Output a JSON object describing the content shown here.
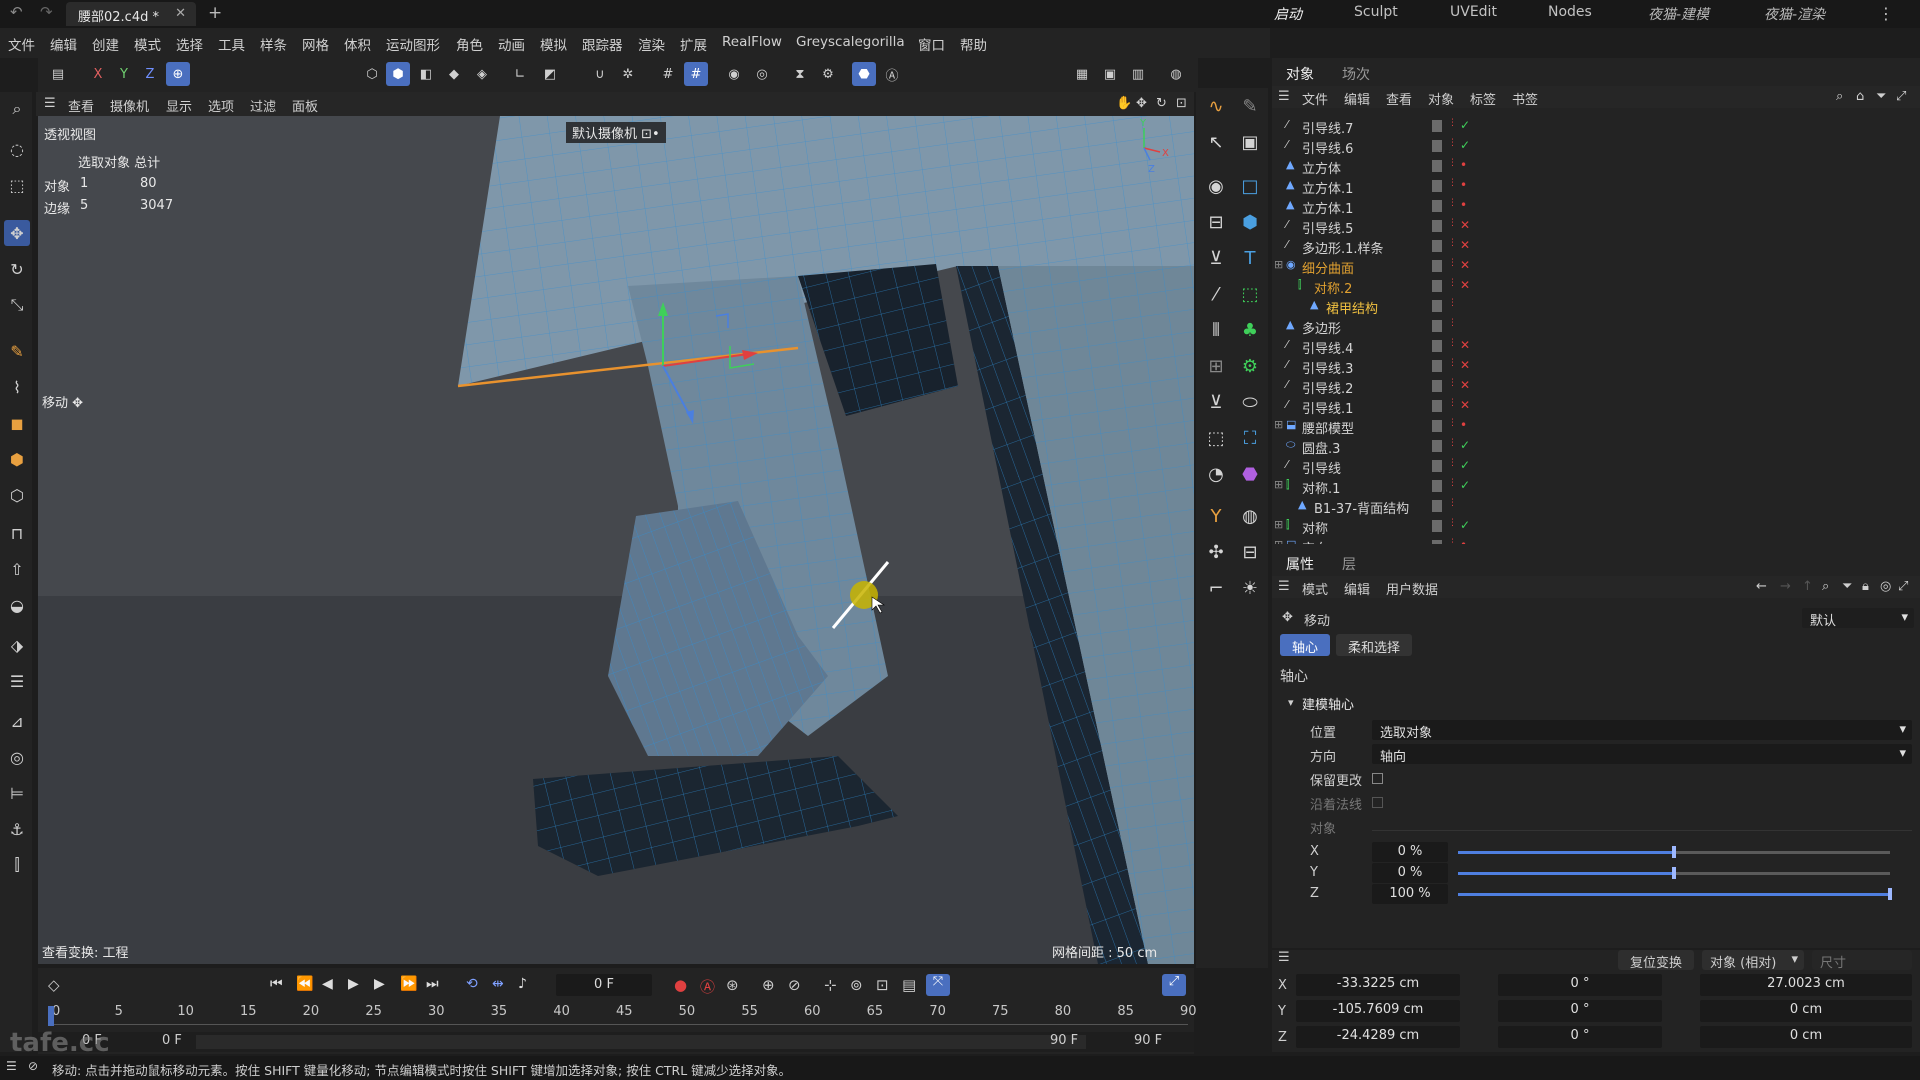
{
  "title_bar": {
    "doc_tab": "腰部02.c4d *",
    "workspaces": [
      "启动",
      "Sculpt",
      "UVEdit",
      "Nodes",
      "夜猫-建模",
      "夜猫-渲染"
    ]
  },
  "menu": [
    "文件",
    "编辑",
    "创建",
    "模式",
    "选择",
    "工具",
    "样条",
    "网格",
    "体积",
    "运动图形",
    "角色",
    "动画",
    "模拟",
    "跟踪器",
    "渲染",
    "扩展",
    "RealFlow",
    "Greyscalegorilla",
    "窗口",
    "帮助"
  ],
  "toolbar_axes": [
    "X",
    "Y",
    "Z"
  ],
  "viewport": {
    "menu": [
      "查看",
      "摄像机",
      "显示",
      "选项",
      "过滤",
      "面板"
    ],
    "name": "透视视图",
    "camera": "默认摄像机 ⊡•",
    "stats_header": "选取对象 总计",
    "stats": [
      {
        "label": "对象",
        "sel": "1",
        "total": "80"
      },
      {
        "label": "边缘",
        "sel": "5",
        "total": "3047"
      }
    ],
    "tool_label": "移动 ✥",
    "view_transform": "查看变换: 工程",
    "grid_spacing": "网格间距 : 50 cm"
  },
  "timeline": {
    "current_frame": "0 F",
    "ticks": [
      "0",
      "5",
      "10",
      "15",
      "20",
      "25",
      "30",
      "35",
      "40",
      "45",
      "50",
      "55",
      "60",
      "65",
      "70",
      "75",
      "80",
      "85",
      "90"
    ],
    "start": "0 F",
    "start2": "0 F",
    "end": "90 F",
    "end2": "90 F"
  },
  "object_manager": {
    "tabs": [
      "对象",
      "场次"
    ],
    "menu": [
      "文件",
      "编辑",
      "查看",
      "对象",
      "标签",
      "书签"
    ],
    "objects": [
      {
        "name": "引导线.7",
        "indent": 0,
        "icon": "spline-icon",
        "status": "✓",
        "status_color": "#3fcf5a",
        "color": "#d4d4d4"
      },
      {
        "name": "引导线.6",
        "indent": 0,
        "icon": "spline-icon",
        "status": "✓",
        "status_color": "#3fcf5a",
        "color": "#d4d4d4"
      },
      {
        "name": "立方体",
        "indent": 0,
        "icon": "polygon-icon",
        "status": "•",
        "status_color": "#e04040",
        "color": "#d4d4d4"
      },
      {
        "name": "立方体.1",
        "indent": 0,
        "icon": "polygon-icon",
        "status": "•",
        "status_color": "#e04040",
        "color": "#d4d4d4"
      },
      {
        "name": "立方体.1",
        "indent": 0,
        "icon": "polygon-icon",
        "status": "•",
        "status_color": "#e04040",
        "color": "#d4d4d4"
      },
      {
        "name": "引导线.5",
        "indent": 0,
        "icon": "spline-icon",
        "status": "✕",
        "status_color": "#e04040",
        "color": "#d4d4d4"
      },
      {
        "name": "多边形.1.样条",
        "indent": 0,
        "icon": "spline-icon",
        "status": "✕",
        "status_color": "#e04040",
        "color": "#d4d4d4"
      },
      {
        "name": "细分曲面",
        "indent": 0,
        "icon": "subdivision-icon",
        "status": "✕",
        "status_color": "#e04040",
        "color": "#e0a030"
      },
      {
        "name": "对称.2",
        "indent": 1,
        "icon": "symmetry-icon",
        "status": "✕",
        "status_color": "#e04040",
        "color": "#e0a030"
      },
      {
        "name": "裙甲结构",
        "indent": 2,
        "icon": "polygon-icon",
        "status": "",
        "status_color": "#e04040",
        "color": "#f0c040"
      },
      {
        "name": "多边形",
        "indent": 0,
        "icon": "polygon-icon",
        "status": "",
        "status_color": "#e04040",
        "color": "#d4d4d4"
      },
      {
        "name": "引导线.4",
        "indent": 0,
        "icon": "spline-icon",
        "status": "✕",
        "status_color": "#e04040",
        "color": "#d4d4d4"
      },
      {
        "name": "引导线.3",
        "indent": 0,
        "icon": "spline-icon",
        "status": "✕",
        "status_color": "#e04040",
        "color": "#d4d4d4"
      },
      {
        "name": "引导线.2",
        "indent": 0,
        "icon": "spline-icon",
        "status": "✕",
        "status_color": "#e04040",
        "color": "#d4d4d4"
      },
      {
        "name": "引导线.1",
        "indent": 0,
        "icon": "spline-icon",
        "status": "✕",
        "status_color": "#e04040",
        "color": "#d4d4d4"
      },
      {
        "name": "腰部模型",
        "indent": 0,
        "icon": "null-icon",
        "status": "•",
        "status_color": "#e04040",
        "color": "#d4d4d4"
      },
      {
        "name": "圆盘.3",
        "indent": 0,
        "icon": "disc-icon",
        "status": "✓",
        "status_color": "#3fcf5a",
        "color": "#d4d4d4"
      },
      {
        "name": "引导线",
        "indent": 0,
        "icon": "spline-icon",
        "status": "✓",
        "status_color": "#3fcf5a",
        "color": "#d4d4d4"
      },
      {
        "name": "对称.1",
        "indent": 0,
        "icon": "symmetry-icon",
        "status": "✓",
        "status_color": "#3fcf5a",
        "color": "#d4d4d4"
      },
      {
        "name": "B1-37-背面结构",
        "indent": 1,
        "icon": "polygon-icon",
        "status": "",
        "status_color": "#e04040",
        "color": "#d4d4d4"
      },
      {
        "name": "对称",
        "indent": 0,
        "icon": "symmetry-icon",
        "status": "✓",
        "status_color": "#3fcf5a",
        "color": "#d4d4d4"
      },
      {
        "name": "空白",
        "indent": 0,
        "icon": "null-icon",
        "status": "•",
        "status_color": "#e04040",
        "color": "#d4d4d4"
      }
    ]
  },
  "attributes": {
    "tabs": [
      "属性",
      "层"
    ],
    "menu": [
      "模式",
      "编辑",
      "用户数据"
    ],
    "tool": "移动",
    "preset": "默认",
    "subtabs": [
      "轴心",
      "柔和选择"
    ],
    "section": "轴心",
    "group": "建模轴心",
    "position_label": "位置",
    "position_value": "选取对象",
    "direction_label": "方向",
    "direction_value": "轴向",
    "keep_changes": "保留更改",
    "along_normals": "沿着法线",
    "object_label": "对象",
    "sliders": [
      {
        "axis": "X",
        "value": "0 %",
        "fraction": 0.5
      },
      {
        "axis": "Y",
        "value": "0 %",
        "fraction": 0.5
      },
      {
        "axis": "Z",
        "value": "100 %",
        "fraction": 1.0
      }
    ]
  },
  "coordinates": {
    "reset_button": "复位变换",
    "mode": "对象 (相对)",
    "size_label": "尺寸",
    "rows": [
      {
        "axis": "X",
        "pos": "-33.3225 cm",
        "rot": "0 °",
        "size": "27.0023 cm"
      },
      {
        "axis": "Y",
        "pos": "-105.7609 cm",
        "rot": "0 °",
        "size": "0 cm"
      },
      {
        "axis": "Z",
        "pos": "-24.4289 cm",
        "rot": "0 °",
        "size": "0 cm"
      }
    ]
  },
  "status_text": "移动: 点击并拖动鼠标移动元素。按住 SHIFT 键量化移动; 节点编辑模式时按住 SHIFT 键增加选择对象; 按住 CTRL 键减少选择对象。",
  "watermark": "tafe.cc",
  "colors": {
    "accent": "#4a6fbf",
    "mesh": "#2e8fd6",
    "bg": "#232323"
  }
}
